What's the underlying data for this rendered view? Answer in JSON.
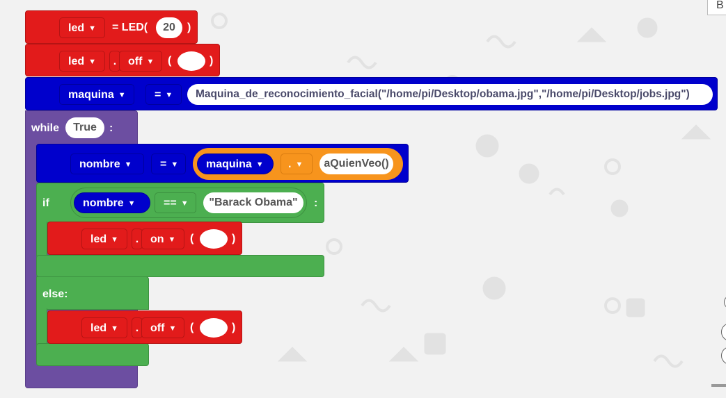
{
  "blocks": {
    "led_assign": {
      "var": "led",
      "eq_text": "= LED(",
      "pin": "20",
      "close": ")"
    },
    "led_off_1": {
      "var": "led",
      "dot": ".",
      "method": "off",
      "open": "(",
      "close": ")"
    },
    "maquina_assign": {
      "var": "maquina",
      "op": "=",
      "value": "Maquina_de_reconocimiento_facial(\"/home/pi/Desktop/obama.jpg\",\"/home/pi/Desktop/jobs.jpg\")"
    },
    "while": {
      "keyword": "while",
      "condition": "True",
      "colon": ":"
    },
    "nombre_assign": {
      "var": "nombre",
      "op": "=",
      "obj": "maquina",
      "dot": ".",
      "method": "aQuienVeo()"
    },
    "if": {
      "keyword": "if",
      "var": "nombre",
      "op": "==",
      "value": "\"Barack Obama\"",
      "colon": ":"
    },
    "led_on": {
      "var": "led",
      "dot": ".",
      "method": "on",
      "open": "(",
      "close": ")"
    },
    "else": {
      "keyword": "else:"
    },
    "led_off_2": {
      "var": "led",
      "dot": ".",
      "method": "off",
      "open": "(",
      "close": ")"
    }
  },
  "corner_button": {
    "label": "B"
  },
  "colors": {
    "red": "#e21b1b",
    "blue": "#0000cc",
    "purple": "#6c4ea1",
    "green": "#4caf50",
    "orange": "#f7941d"
  }
}
